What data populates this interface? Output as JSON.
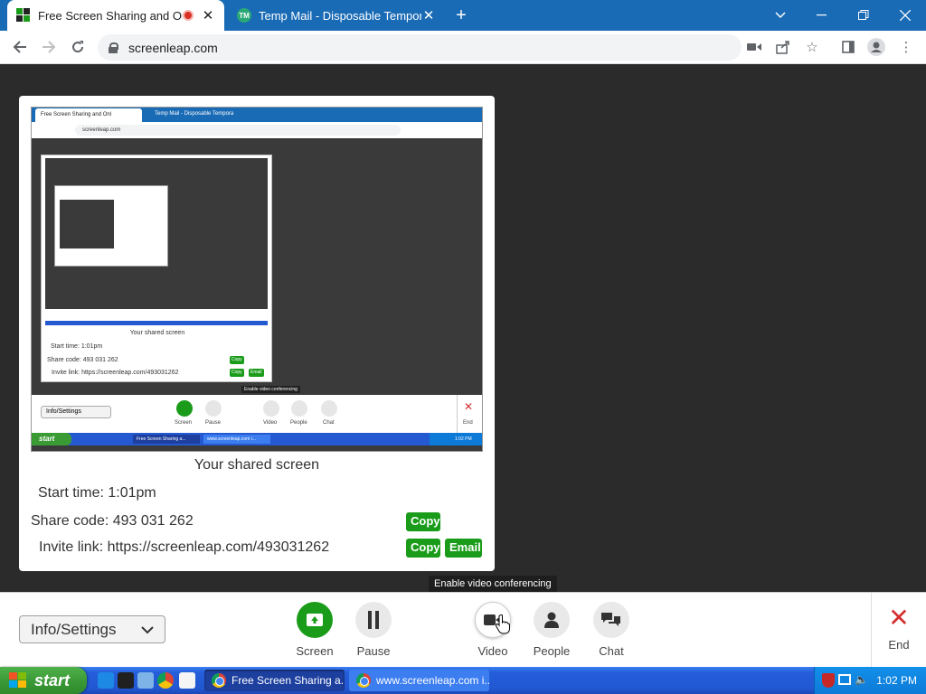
{
  "browser": {
    "tabs": [
      {
        "title": "Free Screen Sharing and Onl",
        "recording": true
      },
      {
        "title": "Temp Mail - Disposable Tempora"
      }
    ],
    "favicon_tm": "TM",
    "url": "screenleap.com"
  },
  "preview": {
    "thumb": {
      "tab1": "Free Screen Sharing and Onl",
      "tab2": "Temp Mail - Disposable Tempora",
      "url": "screenleap.com",
      "shared_label": "Your shared screen",
      "start_time": "Start time: 1:01pm",
      "share_code": "Share code: 493 031 262",
      "invite_link": "Invite link: https://screenleap.com/493031262",
      "copy": "Copy",
      "email": "Email",
      "settings": "Info/Settings",
      "tooltip": "Enable video conferencing",
      "controls": [
        "Screen",
        "Pause",
        "Video",
        "People",
        "Chat",
        "End"
      ],
      "start": "start",
      "task1": "Free Screen Sharing a...",
      "task2": "www.screenleap.com i...",
      "clock": "1:02 PM"
    },
    "shared_label": "Your shared screen",
    "start_time_label": "Start time:",
    "start_time_value": "1:01pm",
    "share_code_label": "Share code:",
    "share_code_value": "493 031 262",
    "invite_link_label": "Invite link:",
    "invite_link_value": "https://screenleap.com/493031262",
    "copy_label": "Copy",
    "email_label": "Email"
  },
  "controls": {
    "settings_label": "Info/Settings",
    "screen": "Screen",
    "pause": "Pause",
    "video": "Video",
    "people": "People",
    "chat": "Chat",
    "end": "End",
    "tooltip": "Enable video conferencing"
  },
  "taskbar": {
    "start": "start",
    "items": [
      "Free Screen Sharing a...",
      "www.screenleap.com i..."
    ],
    "clock": "1:02 PM"
  },
  "colors": {
    "tabstrip": "#1a6bb5",
    "accent_green": "#1a9c1a",
    "end_red": "#d32f2f"
  }
}
